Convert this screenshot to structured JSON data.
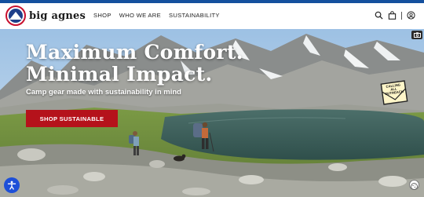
{
  "brand": {
    "name": "big agnes"
  },
  "nav": {
    "items": [
      "SHOP",
      "WHO WE ARE",
      "SUSTAINABILITY"
    ]
  },
  "icons": {
    "search": "search-icon",
    "cart": "bag-icon",
    "account": "account-icon"
  },
  "hero": {
    "title_line1": "Maximum Comfort.",
    "title_line2": "Minimal Impact.",
    "subtitle": "Camp gear made with sustainability in mind",
    "cta_label": "SHOP SUSTAINABLE",
    "badge_text": [
      "CALLING",
      "ALL",
      "OUTREACH"
    ]
  },
  "colors": {
    "top_bar": "#14509e",
    "cta": "#b5121b",
    "accessibility": "#1d4fd8"
  }
}
